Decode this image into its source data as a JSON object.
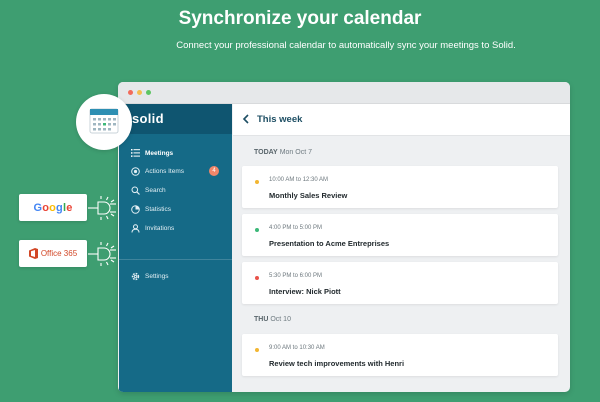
{
  "header": {
    "title": "Synchronize your calendar",
    "subtitle": "Connect your professional calendar to automatically sync your meetings to Solid."
  },
  "window": {
    "traffic_lights": [
      "#f26b5b",
      "#f5bd4f",
      "#5dc563"
    ]
  },
  "sidebar": {
    "logo": "solid",
    "items": [
      {
        "label": "Meetings",
        "icon": "list-icon",
        "active": true
      },
      {
        "label": "Actions Items",
        "icon": "circle-check-icon",
        "badge": "4"
      },
      {
        "label": "Search",
        "icon": "search-icon"
      },
      {
        "label": "Statistics",
        "icon": "pie-chart-icon"
      },
      {
        "label": "Invitations",
        "icon": "user-icon"
      },
      {
        "label": "Settings",
        "icon": "gear-icon"
      }
    ]
  },
  "main": {
    "title": "This week",
    "days": [
      {
        "label": "TODAY",
        "date": "Mon Oct 7"
      },
      {
        "label": "THU",
        "date": "Oct 10"
      }
    ],
    "events": [
      {
        "time": "10:00 AM to 12:30 AM",
        "title": "Monthly Sales Review",
        "color": "#f2b632"
      },
      {
        "time": "4:00 PM to 5:00 PM",
        "title": "Presentation to Acme Entreprises",
        "color": "#3cb878"
      },
      {
        "time": "5:30 PM to 6:00 PM",
        "title": "Interview: Nick Piott",
        "color": "#e8534a"
      },
      {
        "time": "9:00 AM to 10:30 AM",
        "title": "Review tech improvements with Henri",
        "color": "#f2b632"
      }
    ]
  },
  "integrations": {
    "google": "Google",
    "office": "Office 365"
  },
  "colors": {
    "background": "#3e9e71",
    "sidebar": "#156a87",
    "badge": "#f0876a",
    "office": "#d24726"
  }
}
